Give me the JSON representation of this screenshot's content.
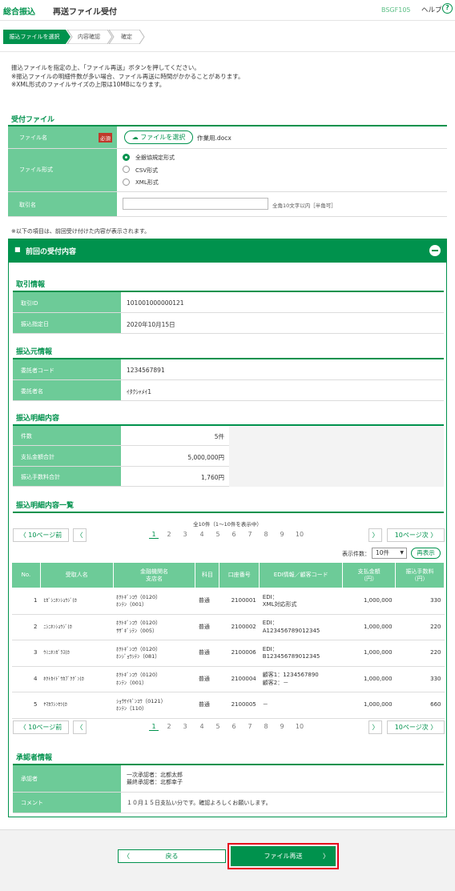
{
  "header": {
    "app_title": "総合振込",
    "page_title": "再送ファイル受付",
    "screen_id": "BSGF105",
    "help_label": "ヘルプ",
    "help_icon": "?"
  },
  "steps": [
    "振込ファイルを選択",
    "内容確認",
    "確定"
  ],
  "intro": [
    "振込ファイルを指定の上、「ファイル再送」ボタンを押してください。",
    "※振込ファイルの明細件数が多い場合、ファイル再送に時間がかかることがあります。",
    "※XML形式のファイルサイズの上限は10MBになります。"
  ],
  "upload": {
    "section_title": "受付ファイル",
    "file_label": "ファイル名",
    "required_badge": "必須",
    "file_button_label": "ファイルを選択",
    "file_name": "作業用.docx",
    "format_label": "ファイル形式",
    "formats": [
      "全銀協規定形式",
      "CSV形式",
      "XML形式"
    ],
    "selected_format": "全銀協規定形式",
    "torihiki_label": "取引名",
    "torihiki_value": "",
    "torihiki_hint": "全角10文字以内［半角可］",
    "note": "※以下の項目は、前回受け付けた内容が表示されます。"
  },
  "previous": {
    "panel_title": "前回の受付内容",
    "transaction": {
      "title": "取引情報",
      "rows": [
        {
          "label": "取引ID",
          "value": "101001000000121"
        },
        {
          "label": "振込指定日",
          "value": "2020年10月15日"
        }
      ]
    },
    "source": {
      "title": "振込元情報",
      "rows": [
        {
          "label": "委託者コード",
          "value": "1234567891"
        },
        {
          "label": "委託者名",
          "value": "ｲﾀｸｼｬﾒｲ1"
        }
      ]
    },
    "detail": {
      "title": "振込明細内容",
      "rows": [
        {
          "label": "件数",
          "value": "5件"
        },
        {
          "label": "支払金額合計",
          "value": "5,000,000円"
        },
        {
          "label": "振込手数料合計",
          "value": "1,760円"
        }
      ]
    },
    "list": {
      "title": "振込明細内容一覧",
      "count_text": "全10件（1～10件を表示中）",
      "prev10": "10ページ前",
      "next10": "10ページ次",
      "pages": [
        "1",
        "2",
        "3",
        "4",
        "5",
        "6",
        "7",
        "8",
        "9",
        "10"
      ],
      "current_page": "1",
      "per_page_label": "表示件数：",
      "per_page_value": "10件",
      "reshow_label": "再表示",
      "columns": [
        "No.",
        "受取人名",
        "金融機関名\n支店名",
        "科目",
        "口座番号",
        "EDI情報／顧客コード",
        "支払金額\n（円）",
        "振込手数料\n（円）"
      ],
      "rows": [
        {
          "no": "1",
          "name": "ﾋｶﾞｼﾆﾎﾝｼｮｳｼﾞ(ｶ",
          "bank": "ﾎｸﾄｷﾞﾝｺｳ（0120）",
          "branch": "ﾎﾝﾃﾝ（001）",
          "kamoku": "普通",
          "account": "2100001",
          "edi1": "EDI：",
          "edi2": "XML対応形式",
          "amount": "1,000,000",
          "fee": "330"
        },
        {
          "no": "2",
          "name": "ﾆｼﾆﾎﾝｼｮｳｼﾞ(ｶ",
          "bank": "ﾎｸﾄｷﾞﾝｺｳ（0120）",
          "branch": "ｻｻﾞｷﾞｼﾃﾝ（005）",
          "kamoku": "普通",
          "account": "2100002",
          "edi1": "EDI：",
          "edi2": "A123456789012345",
          "amount": "1,000,000",
          "fee": "220"
        },
        {
          "no": "3",
          "name": "ｳﾐﾆﾎﾝｶﾞﾗｽ(ｶ",
          "bank": "ﾎｸﾄｷﾞﾝｺｳ（0120）",
          "branch": "ﾎﾝｼﾞｮｳｼﾃﾝ（081）",
          "kamoku": "普通",
          "account": "2100006",
          "edi1": "EDI：",
          "edi2": "B123456789012345",
          "amount": "1,000,000",
          "fee": "220"
        },
        {
          "no": "4",
          "name": "ﾎｸﾄｶｲﾄﾞｳｶﾌﾞｸｸﾞﾝ(ｶ",
          "bank": "ﾎｸﾄｷﾞﾝｺｳ（0120）",
          "branch": "ﾎﾝﾃﾝ（001）",
          "kamoku": "普通",
          "account": "2100004",
          "edi1": "顧客1：1234567890",
          "edi2": "顧客2：－",
          "amount": "1,000,000",
          "fee": "330"
        },
        {
          "no": "5",
          "name": "ﾔﾏｶﾜｼﾝｾﾂ(ｶ",
          "bank": "ｼｮｳｹｲｷﾞﾝｺｳ（0121）",
          "branch": "ﾎﾝﾃﾝ（110）",
          "kamoku": "普通",
          "account": "2100005",
          "edi1": "－",
          "edi2": "",
          "amount": "1,000,000",
          "fee": "660"
        }
      ]
    },
    "approvers": {
      "title": "承認者情報",
      "approver_label": "承認者",
      "approver_line1": "一次承認者：北都太郎",
      "approver_line2": "最終承認者：北都幸子",
      "comment_label": "コメント",
      "comment_value": "１０月１５日支払い分です。確認よろしくお願いします。"
    }
  },
  "footer": {
    "back_label": "戻る",
    "resend_label": "ファイル再送"
  },
  "colors": {
    "brand_green": "#00924d",
    "label_green": "#6dcb98",
    "required_red": "#c0392b",
    "highlight_red": "#e8001c"
  }
}
